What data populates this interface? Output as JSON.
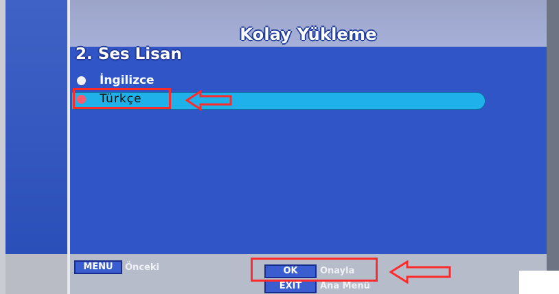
{
  "screen": {
    "title": "Kolay Yükleme",
    "section_title": "2. Ses Lisan"
  },
  "options": [
    {
      "label": "İngilizce",
      "selected": false
    },
    {
      "label": "Türkçe",
      "selected": true
    }
  ],
  "footer": {
    "menu_key": "MENU",
    "menu_label": "Önceki",
    "ok_key": "OK",
    "ok_label": "Onayla",
    "exit_key": "EXIT",
    "exit_label": "Ana Menü"
  },
  "colors": {
    "panel": "#2f55c6",
    "highlight": "#1fb2ea",
    "annotation": "#ff2a2a"
  }
}
